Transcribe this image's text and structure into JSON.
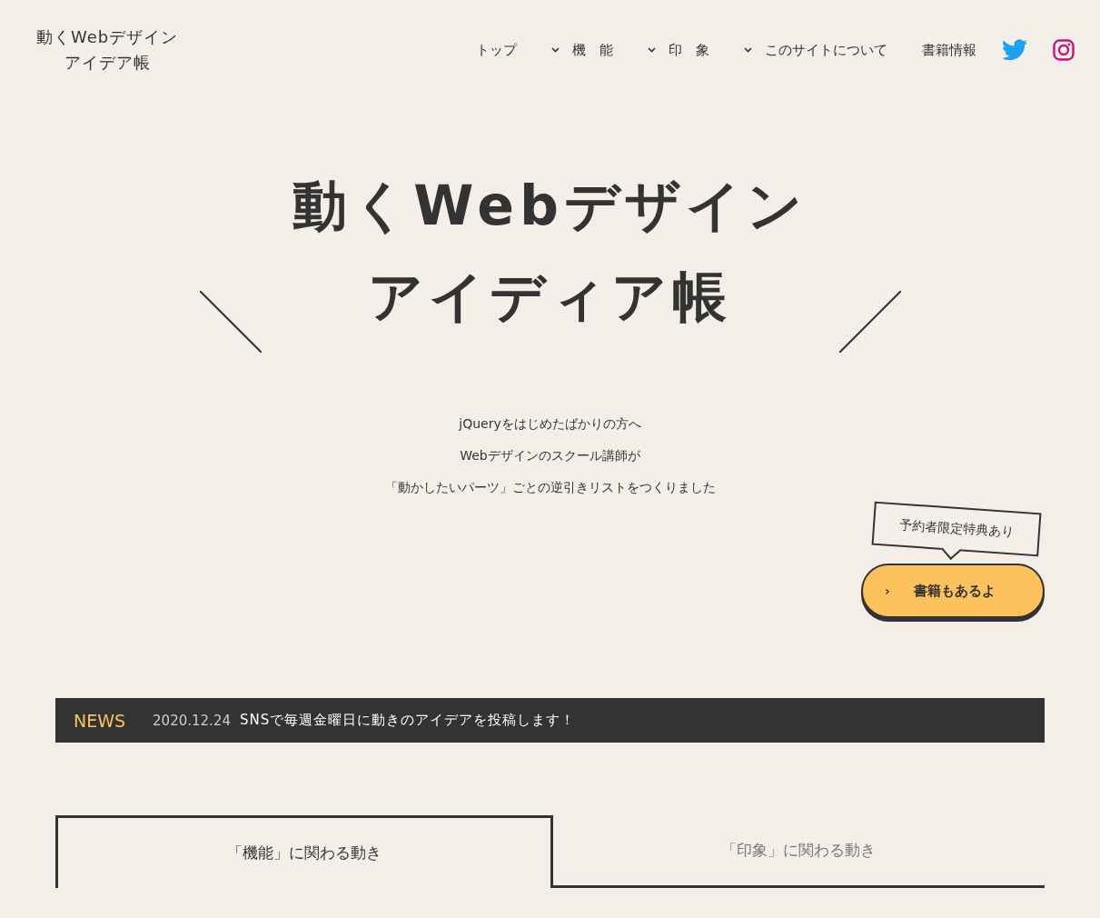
{
  "logo": [
    "動くWebデザイン",
    "アイデア帳"
  ],
  "nav": [
    {
      "label": "トップ",
      "dropdown": false
    },
    {
      "label": "機　能",
      "dropdown": true
    },
    {
      "label": "印　象",
      "dropdown": true
    },
    {
      "label": "このサイトについて",
      "dropdown": true
    },
    {
      "label": "書籍情報",
      "dropdown": false
    }
  ],
  "hero": {
    "title": [
      "動くWebデザイン",
      "アイディア帳"
    ],
    "lead": [
      "jQueryをはじめたばかりの方へ",
      "Webデザインのスクール講師が",
      "「動かしたいパーツ」ごとの逆引きリストをつくりました"
    ]
  },
  "promo": {
    "callout": "予約者限定特典あり",
    "button": "書籍もあるよ",
    "arrow": "›"
  },
  "news": {
    "label": "NEWS",
    "date": "2020.12.24",
    "text": "SNSで毎週金曜日に動きのアイデアを投稿します！"
  },
  "tabs": [
    {
      "label": "「機能」に関わる動き",
      "selected": true
    },
    {
      "label": "「印象」に関わる動き",
      "selected": false
    }
  ]
}
